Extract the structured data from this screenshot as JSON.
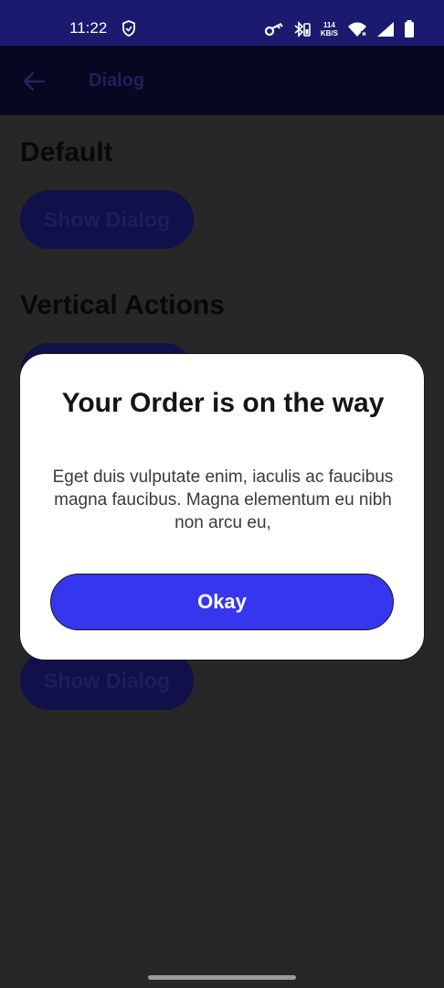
{
  "status_bar": {
    "time": "11:22",
    "speed_value": "114",
    "speed_unit": "KB/S",
    "icons": [
      "vpn-shield-icon",
      "key-icon",
      "bluetooth-battery-icon",
      "wifi-icon",
      "cellular-signal-icon",
      "battery-icon"
    ]
  },
  "app_bar": {
    "title": "Dialog",
    "back_icon": "arrow-left-icon"
  },
  "sections": {
    "default_title": "Default",
    "default_button": "Show Dialog",
    "vertical_title": "Vertical Actions",
    "lower_button": "Show Dialog"
  },
  "dialog": {
    "title": "Your Order is on the way",
    "body": "Eget duis vulputate enim, iaculis ac faucibus magna faucibus. Magna elementum eu nibh non arcu eu,",
    "action": "Okay"
  },
  "colors": {
    "status_bar": "#1a1a6e",
    "scrim_background": "#272727",
    "primary": "#3636ef",
    "dialog_surface": "#ffffff"
  }
}
